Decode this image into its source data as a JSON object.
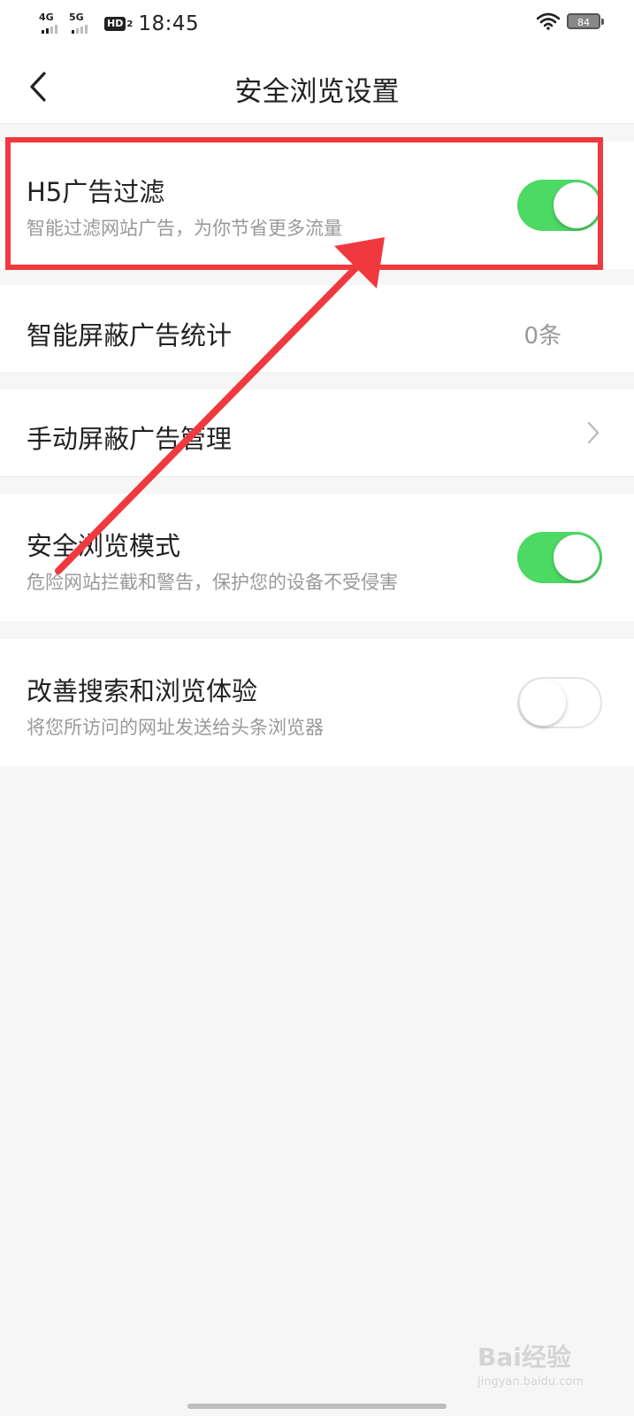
{
  "status_bar": {
    "network_1": "4G",
    "network_2": "5G",
    "hd_label": "HD",
    "hd_sub": "2",
    "time": "18:45",
    "battery_level": "84"
  },
  "nav": {
    "title": "安全浏览设置",
    "back_icon": "chevron-left-icon"
  },
  "settings": {
    "h5_ad_filter": {
      "title": "H5广告过滤",
      "subtitle": "智能过滤网站广告，为你节省更多流量",
      "enabled": true
    },
    "ad_block_stats": {
      "title": "智能屏蔽广告统计",
      "value": "0条"
    },
    "manual_ad_block": {
      "title": "手动屏蔽广告管理"
    },
    "safe_browsing": {
      "title": "安全浏览模式",
      "subtitle": "危险网站拦截和警告，保护您的设备不受侵害",
      "enabled": true
    },
    "improve_experience": {
      "title": "改善搜索和浏览体验",
      "subtitle": "将您所访问的网址发送给头条浏览器",
      "enabled": false
    }
  },
  "colors": {
    "toggle_on": "#4cd964",
    "highlight": "#f0393f"
  },
  "watermark": {
    "brand": "Bai经验",
    "url": "jingyan.baidu.com"
  }
}
